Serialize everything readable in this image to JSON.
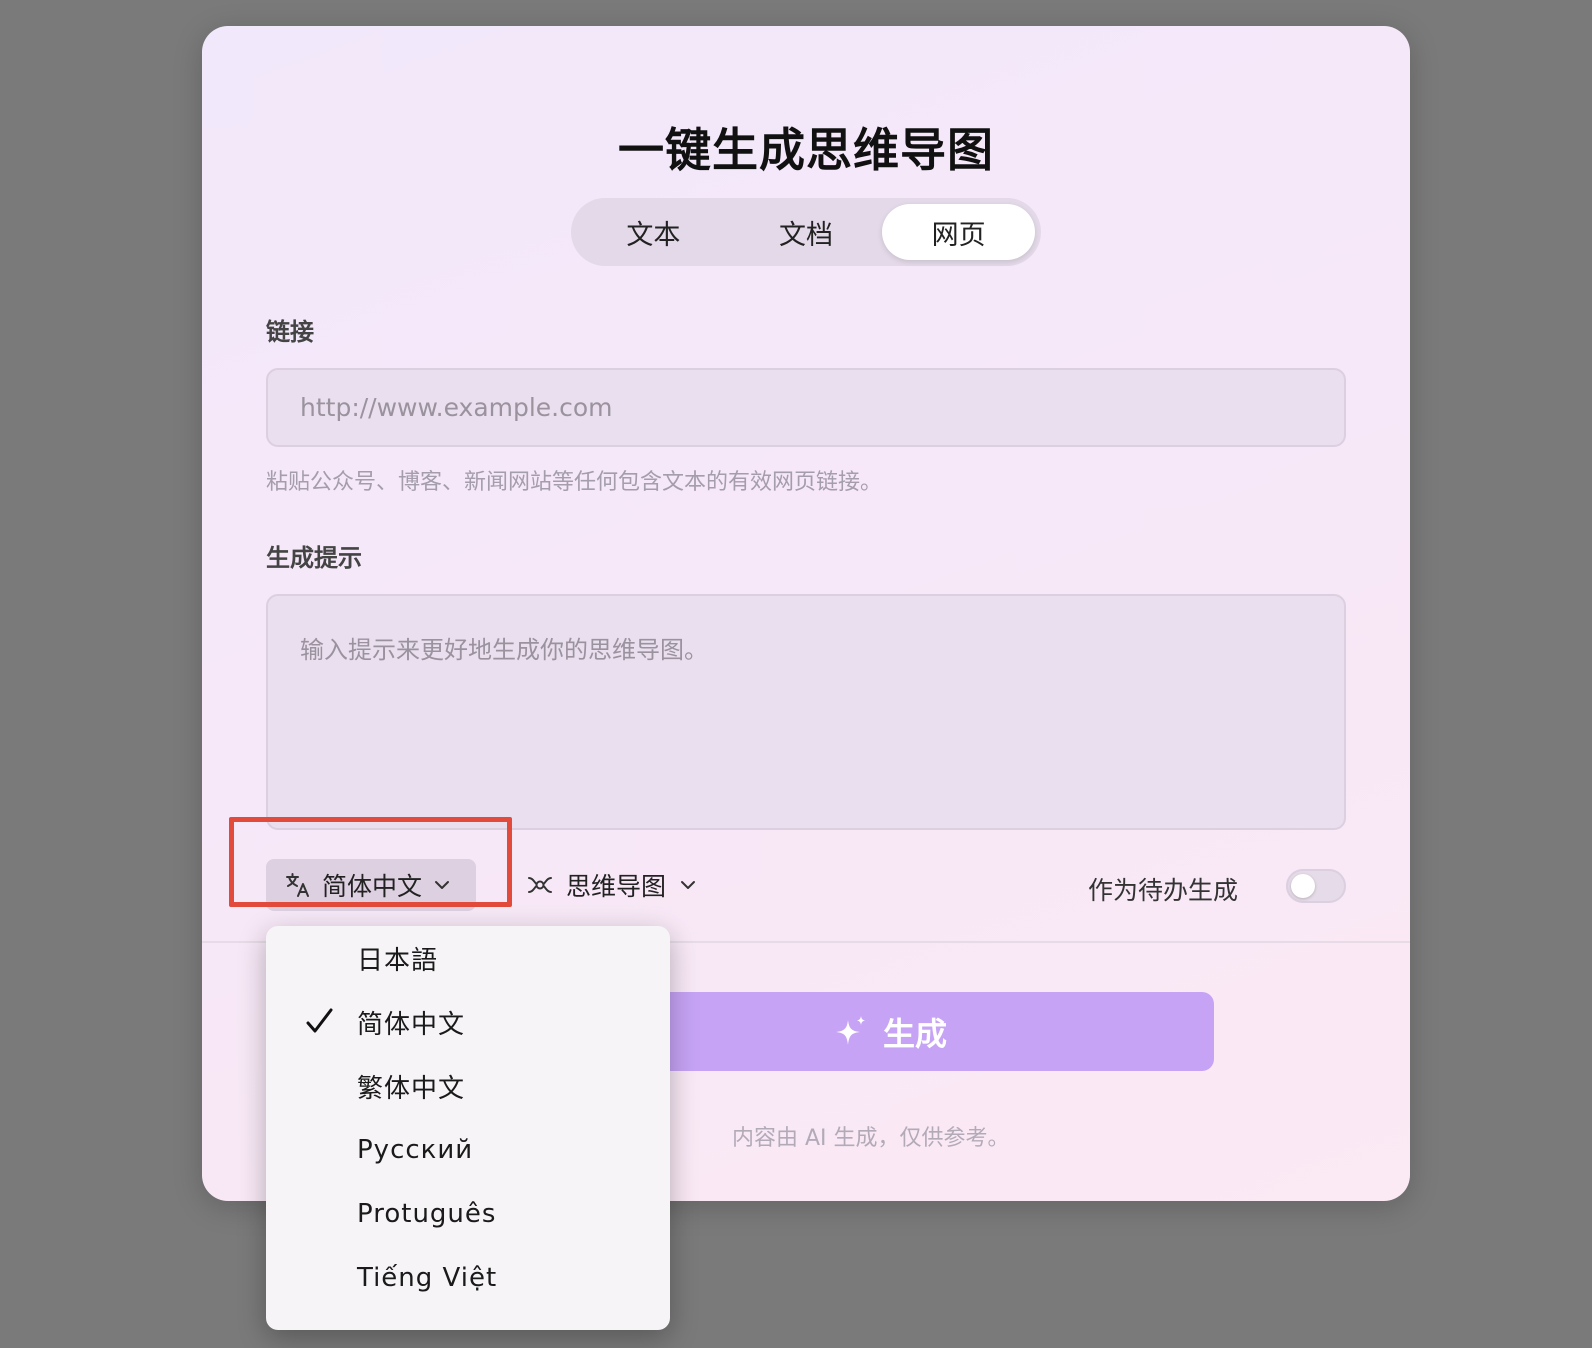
{
  "title": "一键生成思维导图",
  "tabs": [
    {
      "label": "文本"
    },
    {
      "label": "文档"
    },
    {
      "label": "网页",
      "active": true
    }
  ],
  "link": {
    "label": "链接",
    "placeholder": "http://www.example.com",
    "value": "",
    "hint": "粘贴公众号、博客、新闻网站等任何包含文本的有效网页链接。"
  },
  "prompt": {
    "label": "生成提示",
    "placeholder": "输入提示来更好地生成你的思维导图。",
    "value": ""
  },
  "options": {
    "language_selected": "简体中文",
    "language_icon": "translate-icon",
    "output_type": "思维导图",
    "output_type_icon": "mindmap-icon",
    "todo_label": "作为待办生成",
    "todo_enabled": false
  },
  "generate": {
    "label": "生成",
    "icon": "sparkle-icon",
    "color": "#c6a3f5"
  },
  "disclaimer": "内容由 AI 生成，仅供参考。",
  "language_menu": {
    "items": [
      {
        "label": "日本語",
        "checked": false
      },
      {
        "label": "简体中文",
        "checked": true
      },
      {
        "label": "繁体中文",
        "checked": false
      },
      {
        "label": "Русский",
        "checked": false
      },
      {
        "label": "Protuguês",
        "checked": false
      },
      {
        "label": "Tiếng Việt",
        "checked": false
      }
    ]
  },
  "highlight_color": "#e24a3b"
}
